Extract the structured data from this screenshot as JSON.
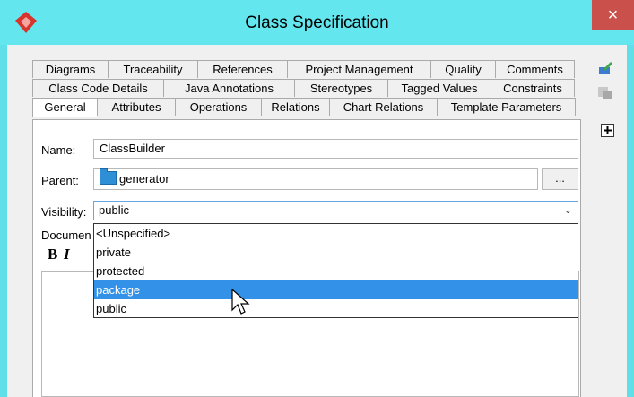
{
  "window": {
    "title": "Class Specification",
    "close_label": "×"
  },
  "tabs": {
    "row1": [
      "Diagrams",
      "Traceability",
      "References",
      "Project Management",
      "Quality",
      "Comments"
    ],
    "row2": [
      "Class Code Details",
      "Java Annotations",
      "Stereotypes",
      "Tagged Values",
      "Constraints"
    ],
    "row3": [
      "General",
      "Attributes",
      "Operations",
      "Relations",
      "Chart Relations",
      "Template Parameters"
    ],
    "active": "General"
  },
  "form": {
    "name_label": "Name:",
    "name_value": "ClassBuilder",
    "parent_label": "Parent:",
    "parent_value": "generator",
    "parent_button": "...",
    "visibility_label": "Visibility:",
    "visibility_value": "public",
    "documentation_label": "Documen",
    "bold_label": "B",
    "italic_label": "I"
  },
  "dropdown": {
    "options": [
      "<Unspecified>",
      "private",
      "protected",
      "package",
      "public"
    ],
    "highlighted": "package"
  },
  "colors": {
    "titlebar": "#63e6ee",
    "close": "#c9504b",
    "highlight": "#3391e8"
  }
}
